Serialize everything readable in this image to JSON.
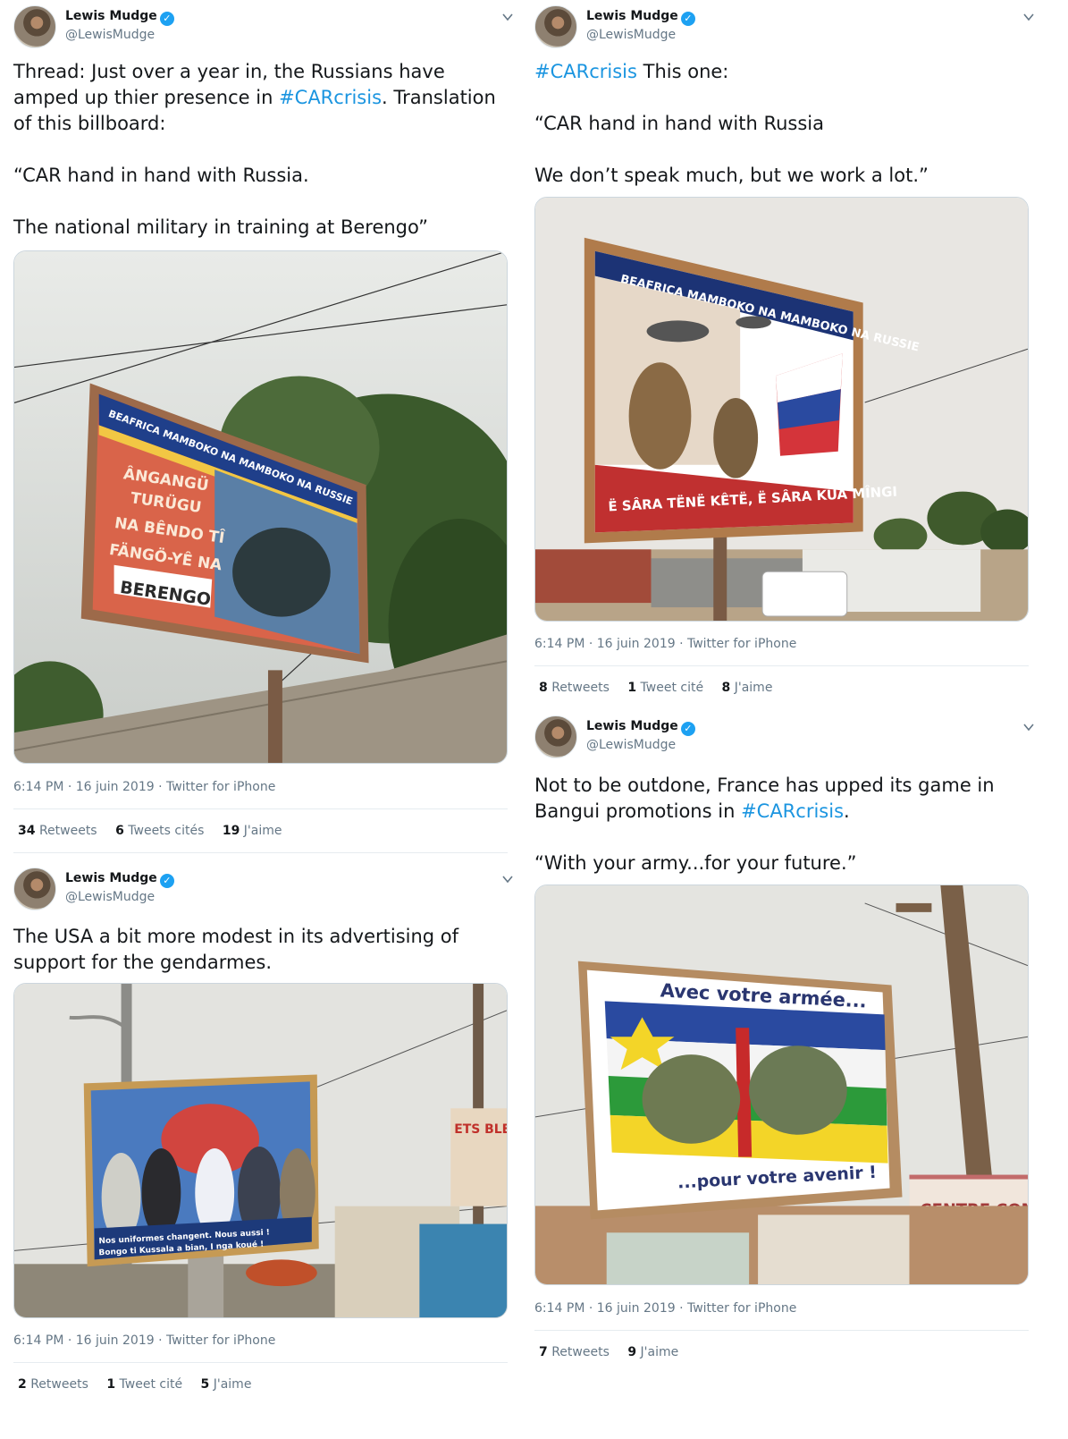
{
  "colors": {
    "link": "#1b95e0",
    "verified": "#1da1f2",
    "muted": "#657786"
  },
  "tweets": [
    {
      "author": {
        "name": "Lewis Mudge",
        "handle": "@LewisMudge",
        "verified_icon": "verified-badge-icon"
      },
      "text_parts": [
        "Thread: Just over a year in, the Russians have amped up thier presence in ",
        "#CARcrisis",
        ". Translation of this billboard:\n\n“CAR hand in hand with Russia.\n\nThe national military in training at Berengo”"
      ],
      "photo": {
        "billboard_title": "BEAFRICA MAMBOKO NA MAMBOKO NA RUSSIE",
        "billboard_lines": [
          "ÂNGANGÜ",
          "TURÜGU",
          "NA BÊNDO TÎ",
          "FÄNGÖ-YÊ NA"
        ],
        "billboard_place": "BERENGO"
      },
      "meta": "6:14 PM · 16 juin 2019 · Twitter for iPhone",
      "stats": [
        {
          "count": "34",
          "label": "Retweets"
        },
        {
          "count": "6",
          "label": "Tweets cités"
        },
        {
          "count": "19",
          "label": "J'aime"
        }
      ]
    },
    {
      "author": {
        "name": "Lewis Mudge",
        "handle": "@LewisMudge",
        "verified_icon": "verified-badge-icon"
      },
      "text_parts": [
        "",
        "#CARcrisis",
        " This one:\n\n“CAR hand in hand with Russia\n\nWe don’t speak much, but we work a lot.”"
      ],
      "photo": {
        "billboard_title": "BEAFRICA MAMBOKO NA MAMBOKO NA RUSSIE",
        "billboard_bottom": "Ë SÂRA TËNË KÊTË, Ë SÂRA KUA MÎNGI"
      },
      "meta": "6:14 PM · 16 juin 2019 · Twitter for iPhone",
      "stats": [
        {
          "count": "8",
          "label": "Retweets"
        },
        {
          "count": "1",
          "label": "Tweet cité"
        },
        {
          "count": "8",
          "label": "J'aime"
        }
      ]
    },
    {
      "author": {
        "name": "Lewis Mudge",
        "handle": "@LewisMudge",
        "verified_icon": "verified-badge-icon"
      },
      "text_parts": [
        "Not to be outdone, France has upped its game in Bangui promotions in ",
        "#CARcrisis",
        ".\n\n“With your army...for your future.”"
      ],
      "photo": {
        "billboard_top": "Avec votre armée...",
        "billboard_bottom": "...pour votre avenir !",
        "sign_text": "CENTRE COMM"
      },
      "meta": "6:14 PM · 16 juin 2019 · Twitter for iPhone",
      "stats": [
        {
          "count": "7",
          "label": "Retweets"
        },
        {
          "count": "9",
          "label": "J'aime"
        }
      ]
    },
    {
      "author": {
        "name": "Lewis Mudge",
        "handle": "@LewisMudge",
        "verified_icon": "verified-badge-icon"
      },
      "text_parts": [
        "The USA a bit more modest in its advertising of support for the gendarmes.",
        "",
        ""
      ],
      "photo": {
        "billboard_caption_1": "Nos uniformes changent. Nous aussi !",
        "billboard_caption_2": "Bongo ti Kussala a bian, I nga koué !",
        "shop_sign": "ETS BLESS"
      },
      "meta": "6:14 PM · 16 juin 2019 · Twitter for iPhone",
      "stats": [
        {
          "count": "2",
          "label": "Retweets"
        },
        {
          "count": "1",
          "label": "Tweet cité"
        },
        {
          "count": "5",
          "label": "J'aime"
        }
      ]
    }
  ]
}
